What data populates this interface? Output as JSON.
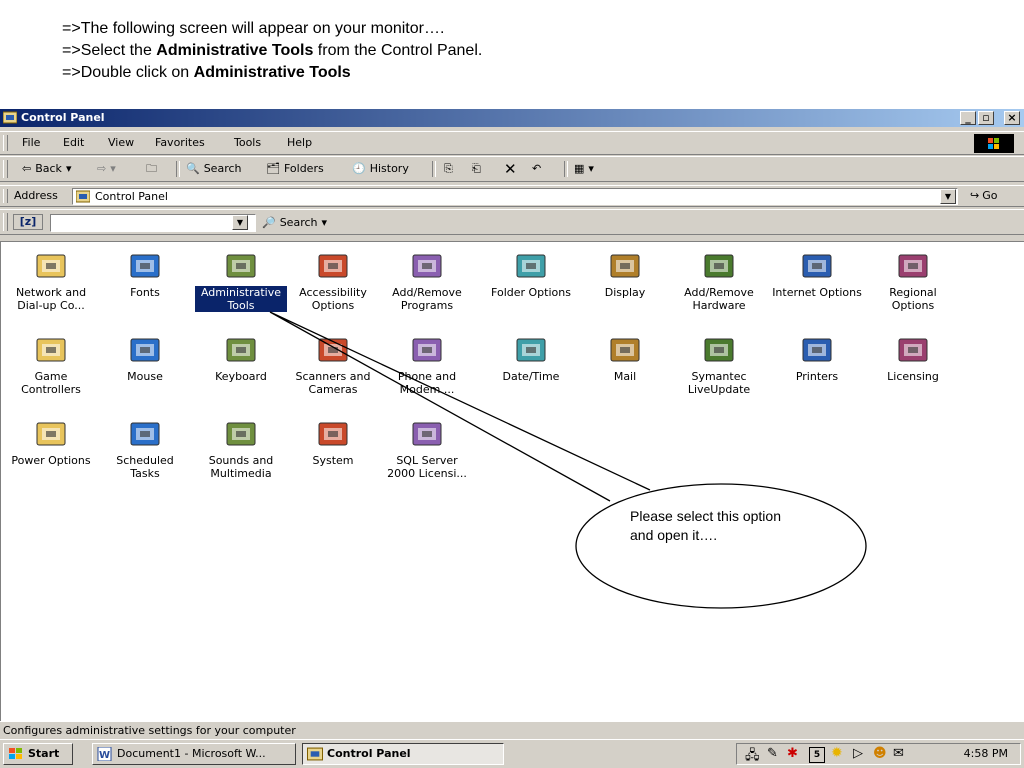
{
  "instructions": {
    "line1": "=>The following screen will appear on your monitor….",
    "line2_pre": "=>Select the ",
    "line2_bold": "Administrative Tools",
    "line2_post": " from the Control Panel.",
    "line3_pre": "=>Double click on ",
    "line3_bold": "Administrative Tools"
  },
  "window": {
    "title": "Control Panel",
    "min": "_",
    "max": "▫",
    "close": "×"
  },
  "menu": [
    "File",
    "Edit",
    "View",
    "Favorites",
    "Tools",
    "Help"
  ],
  "toolbar": {
    "back": "Back",
    "search": "Search",
    "folders": "Folders",
    "history": "History"
  },
  "address": {
    "label": "Address",
    "value": "Control Panel",
    "go": "Go"
  },
  "searchbar": {
    "label": "Search"
  },
  "icons": [
    {
      "label": "Network and Dial-up Co...",
      "icon": "network-icon"
    },
    {
      "label": "Fonts",
      "icon": "fonts-icon"
    },
    {
      "label": "Administrative Tools",
      "icon": "admin-tools-icon",
      "selected": true
    },
    {
      "label": "Accessibility Options",
      "icon": "accessibility-icon"
    },
    {
      "label": "Add/Remove Programs",
      "icon": "add-remove-programs-icon"
    },
    {
      "label": "Folder Options",
      "icon": "folder-options-icon"
    },
    {
      "label": "Display",
      "icon": "display-icon"
    },
    {
      "label": "Add/Remove Hardware",
      "icon": "add-remove-hardware-icon"
    },
    {
      "label": "Internet Options",
      "icon": "internet-options-icon"
    },
    {
      "label": "Regional Options",
      "icon": "regional-options-icon"
    },
    {
      "label": "Game Controllers",
      "icon": "game-controllers-icon"
    },
    {
      "label": "Mouse",
      "icon": "mouse-icon"
    },
    {
      "label": "Keyboard",
      "icon": "keyboard-icon"
    },
    {
      "label": "Scanners and Cameras",
      "icon": "scanners-icon"
    },
    {
      "label": "Phone and Modem ...",
      "icon": "phone-modem-icon"
    },
    {
      "label": "Date/Time",
      "icon": "date-time-icon"
    },
    {
      "label": "Mail",
      "icon": "mail-icon"
    },
    {
      "label": "Symantec LiveUpdate",
      "icon": "liveupdate-icon"
    },
    {
      "label": "Printers",
      "icon": "printers-icon"
    },
    {
      "label": "Licensing",
      "icon": "licensing-icon"
    },
    {
      "label": "Power Options",
      "icon": "power-options-icon"
    },
    {
      "label": "Scheduled Tasks",
      "icon": "scheduled-tasks-icon"
    },
    {
      "label": "Sounds and Multimedia",
      "icon": "sounds-icon"
    },
    {
      "label": "System",
      "icon": "system-icon"
    },
    {
      "label": "SQL Server 2000 Licensi...",
      "icon": "sql-licensing-icon"
    }
  ],
  "status": "Configures administrative settings for your computer",
  "taskbar": {
    "start": "Start",
    "task1": "Document1 - Microsoft W...",
    "task2": "Control Panel",
    "clock": "4:58 PM"
  },
  "callout": {
    "line1": "Please select this option",
    "line2": "and open it…."
  },
  "colors": {
    "titlebar_start": "#0a246a",
    "titlebar_end": "#a6caf0",
    "chrome": "#d4d0c8",
    "selection": "#0a246a"
  }
}
